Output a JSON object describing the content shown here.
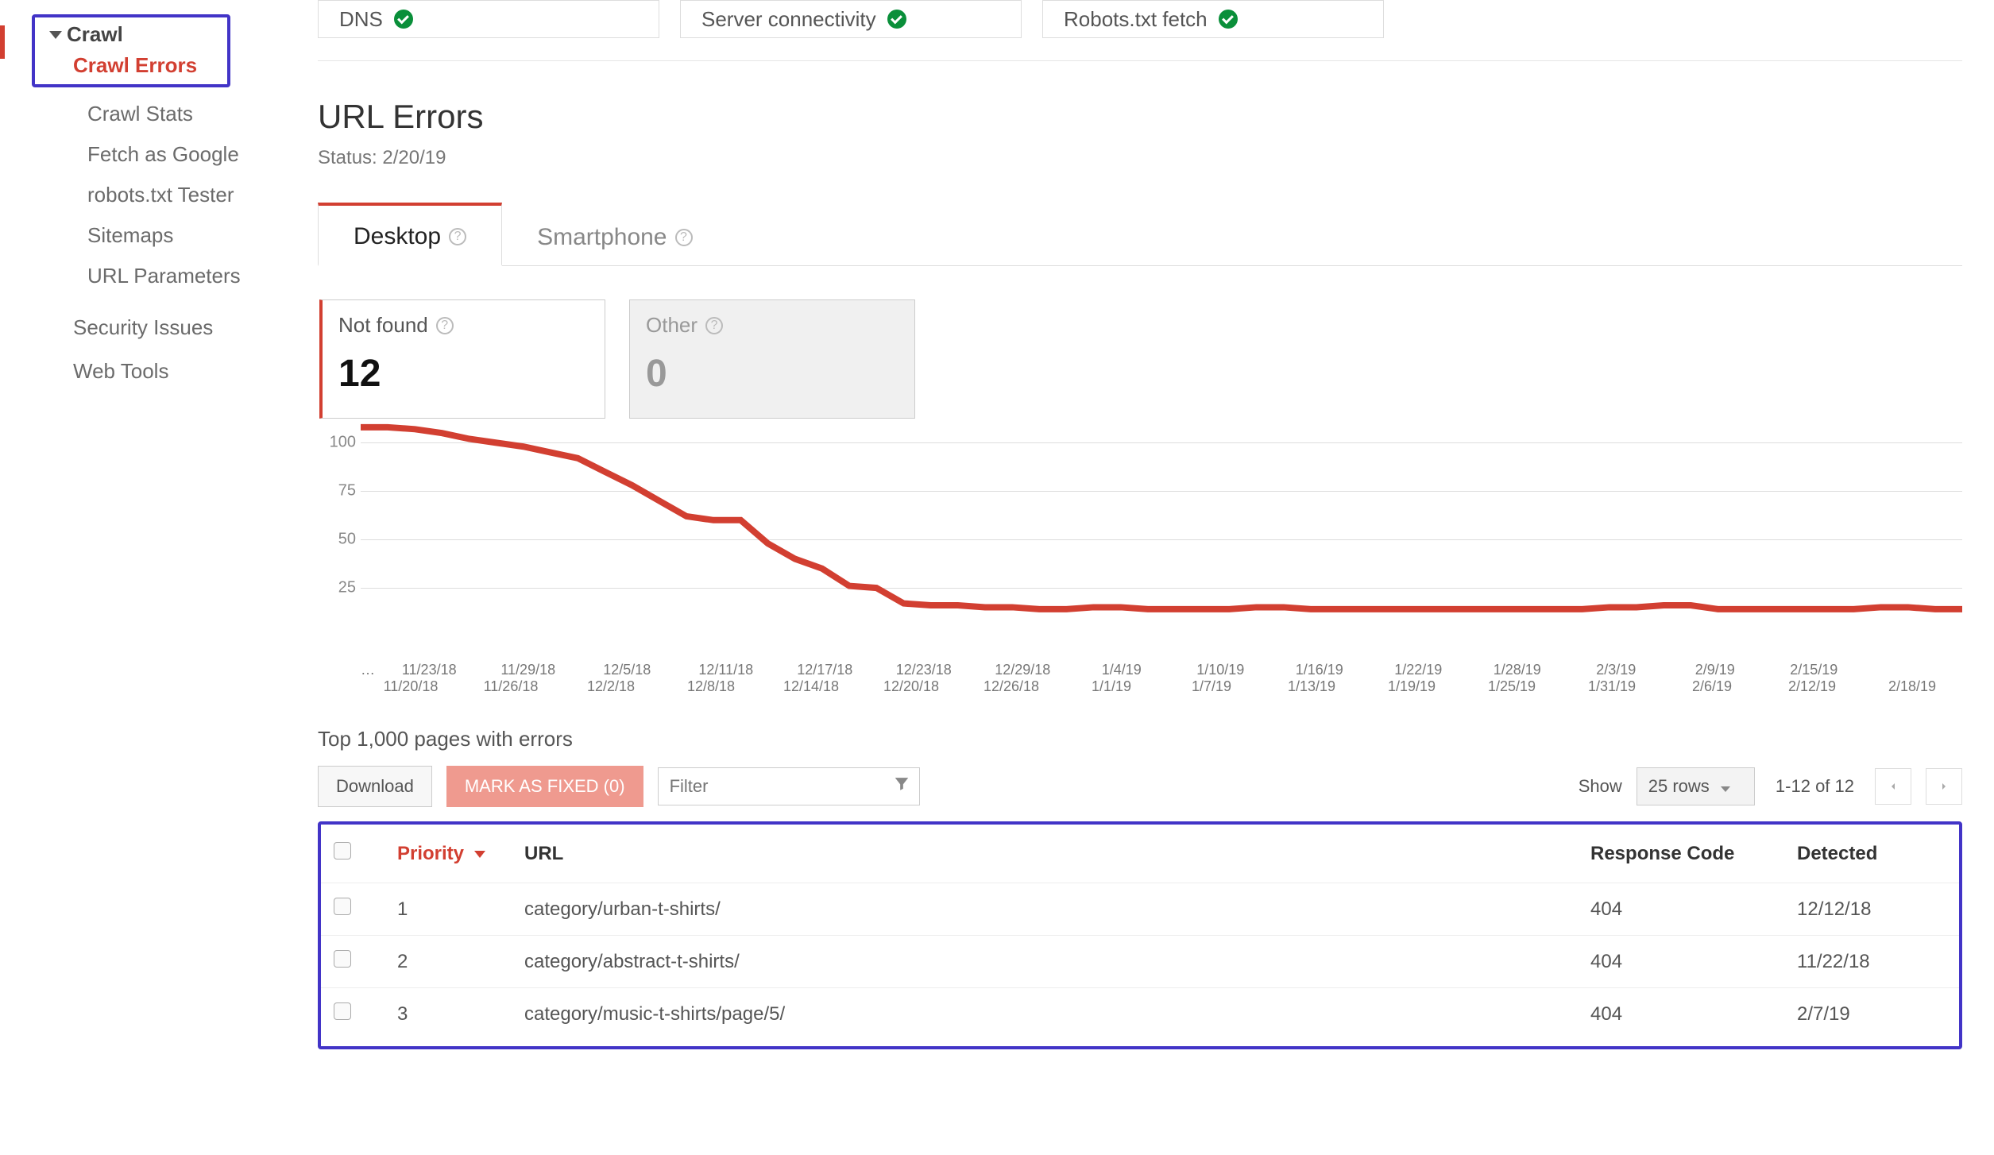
{
  "sidebar": {
    "crawl_header": "Crawl",
    "crawl_errors": "Crawl Errors",
    "items": [
      "Crawl Stats",
      "Fetch as Google",
      "robots.txt Tester",
      "Sitemaps",
      "URL Parameters"
    ],
    "top_items": [
      "Security Issues",
      "Web Tools"
    ]
  },
  "status_boxes": [
    {
      "label": "DNS"
    },
    {
      "label": "Server connectivity"
    },
    {
      "label": "Robots.txt fetch"
    }
  ],
  "url_errors": {
    "title": "URL Errors",
    "status": "Status: 2/20/19"
  },
  "device_tabs": {
    "desktop": "Desktop",
    "smartphone": "Smartphone"
  },
  "error_tiles": {
    "not_found": {
      "label": "Not found",
      "count": "12"
    },
    "other": {
      "label": "Other",
      "count": "0"
    }
  },
  "chart_data": {
    "type": "line",
    "ylim": [
      0,
      110
    ],
    "yticks": [
      25,
      50,
      75,
      100
    ],
    "xticks_top": [
      "…",
      "11/23/18",
      "11/29/18",
      "12/5/18",
      "12/11/18",
      "12/17/18",
      "12/23/18",
      "12/29/18",
      "1/4/19",
      "1/10/19",
      "1/16/19",
      "1/22/19",
      "1/28/19",
      "2/3/19",
      "2/9/19",
      "2/15/19",
      ""
    ],
    "xticks_bottom": [
      "11/20/18",
      "11/26/18",
      "12/2/18",
      "12/8/18",
      "12/14/18",
      "12/20/18",
      "12/26/18",
      "1/1/19",
      "1/7/19",
      "1/13/19",
      "1/19/19",
      "1/25/19",
      "1/31/19",
      "2/6/19",
      "2/12/19",
      "2/18/19"
    ],
    "series": [
      {
        "name": "Not found",
        "color": "#d23f31",
        "values": [
          108,
          108,
          107,
          105,
          102,
          100,
          98,
          95,
          92,
          85,
          78,
          70,
          62,
          60,
          60,
          48,
          40,
          35,
          26,
          25,
          17,
          16,
          16,
          15,
          15,
          14,
          14,
          15,
          15,
          14,
          14,
          14,
          14,
          15,
          15,
          14,
          14,
          14,
          14,
          14,
          14,
          14,
          14,
          14,
          14,
          14,
          15,
          15,
          16,
          16,
          14,
          14,
          14,
          14,
          14,
          14,
          15,
          15,
          14,
          14
        ]
      }
    ]
  },
  "top_pages_label": "Top 1,000 pages with errors",
  "controls": {
    "download": "Download",
    "mark_fixed": "MARK AS FIXED (0)",
    "filter_placeholder": "Filter",
    "show_label": "Show",
    "rows_select": "25 rows",
    "range": "1-12 of 12"
  },
  "table": {
    "headers": {
      "priority": "Priority",
      "url": "URL",
      "response": "Response Code",
      "detected": "Detected"
    },
    "rows": [
      {
        "priority": "1",
        "url": "category/urban-t-shirts/",
        "response": "404",
        "detected": "12/12/18"
      },
      {
        "priority": "2",
        "url": "category/abstract-t-shirts/",
        "response": "404",
        "detected": "11/22/18"
      },
      {
        "priority": "3",
        "url": "category/music-t-shirts/page/5/",
        "response": "404",
        "detected": "2/7/19"
      }
    ]
  }
}
